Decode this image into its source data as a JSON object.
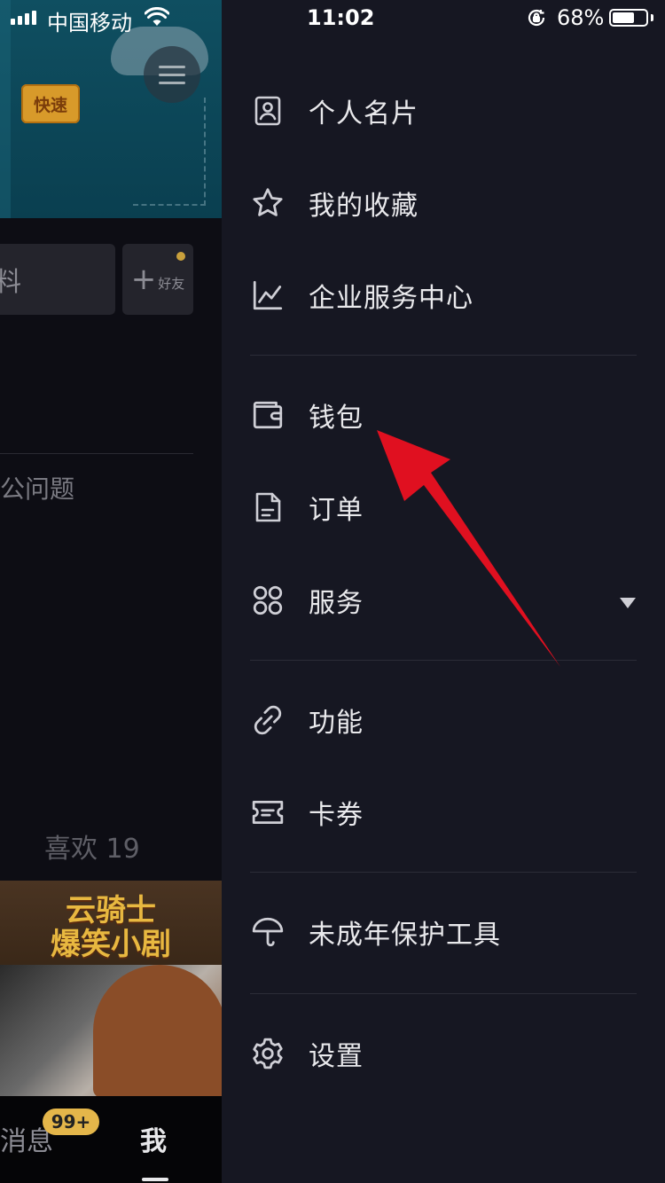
{
  "status_bar": {
    "carrier": "中国移动",
    "time": "11:02",
    "battery_percent": "68%",
    "battery_level": 0.68
  },
  "background_profile": {
    "banner_tag": "快速",
    "edit_button_partial": "料",
    "add_friend_label": "好友",
    "problem_text_partial": "公问题",
    "likes_label": "喜欢 19",
    "video_title_line1": "云骑士",
    "video_title_line2": "爆笑小剧",
    "tabs": {
      "messages_partial": "消息",
      "messages_badge": "99+",
      "me": "我"
    }
  },
  "drawer": {
    "items": [
      {
        "label": "个人名片",
        "icon": "profile-card-icon"
      },
      {
        "label": "我的收藏",
        "icon": "star-icon"
      },
      {
        "label": "企业服务中心",
        "icon": "chart-line-icon"
      },
      {
        "label": "钱包",
        "icon": "wallet-icon"
      },
      {
        "label": "订单",
        "icon": "document-icon"
      },
      {
        "label": "服务",
        "icon": "grid-icon"
      },
      {
        "label": "功能",
        "icon": "link-icon"
      },
      {
        "label": "卡券",
        "icon": "ticket-icon"
      },
      {
        "label": "未成年保护工具",
        "icon": "umbrella-icon"
      },
      {
        "label": "设置",
        "icon": "gear-icon"
      }
    ]
  },
  "colors": {
    "drawer_bg": "#161722",
    "annotation_arrow": "#e01020",
    "badge": "#e4b64a"
  }
}
